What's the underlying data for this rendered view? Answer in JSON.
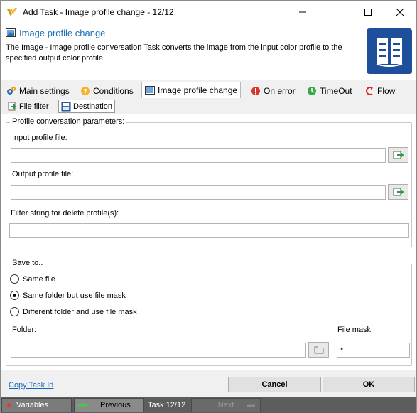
{
  "window": {
    "title": "Add Task - Image profile change - 12/12"
  },
  "header": {
    "title": "Image profile change",
    "description": "The Image - Image profile conversation Task converts the image from the input color profile to the specified output color profile."
  },
  "tabs": [
    {
      "label": "Main settings",
      "icon": "gears-icon"
    },
    {
      "label": "Conditions",
      "icon": "conditions-icon"
    },
    {
      "label": "Image profile change",
      "icon": "image-icon"
    },
    {
      "label": "On error",
      "icon": "error-icon"
    },
    {
      "label": "TimeOut",
      "icon": "timeout-icon"
    },
    {
      "label": "Flow",
      "icon": "flow-icon"
    }
  ],
  "subtabs": [
    {
      "label": "File filter"
    },
    {
      "label": "Destination"
    }
  ],
  "profile_group": {
    "legend": "Profile conversation parameters:",
    "input_label": "Input profile file:",
    "input_value": "",
    "output_label": "Output profile file:",
    "output_value": "",
    "filter_label": "Filter string for delete profile(s):",
    "filter_value": ""
  },
  "save_group": {
    "legend": "Save to..",
    "options": [
      {
        "label": "Same file",
        "selected": false
      },
      {
        "label": "Same folder but use file mask",
        "selected": true
      },
      {
        "label": "Different folder and use file mask",
        "selected": false
      }
    ],
    "folder_label": "Folder:",
    "folder_value": "",
    "mask_label": "File mask:",
    "mask_value": "*"
  },
  "footer": {
    "copy_link": "Copy Task Id",
    "cancel": "Cancel",
    "ok": "OK"
  },
  "bottombar": {
    "variables": "Variables",
    "previous": "Previous",
    "task_counter": "Task 12/12",
    "next": "Next"
  },
  "colors": {
    "accent": "#1f6fb5",
    "big_icon": "#1e4f9a",
    "bottombar": "#5d5d5d"
  }
}
